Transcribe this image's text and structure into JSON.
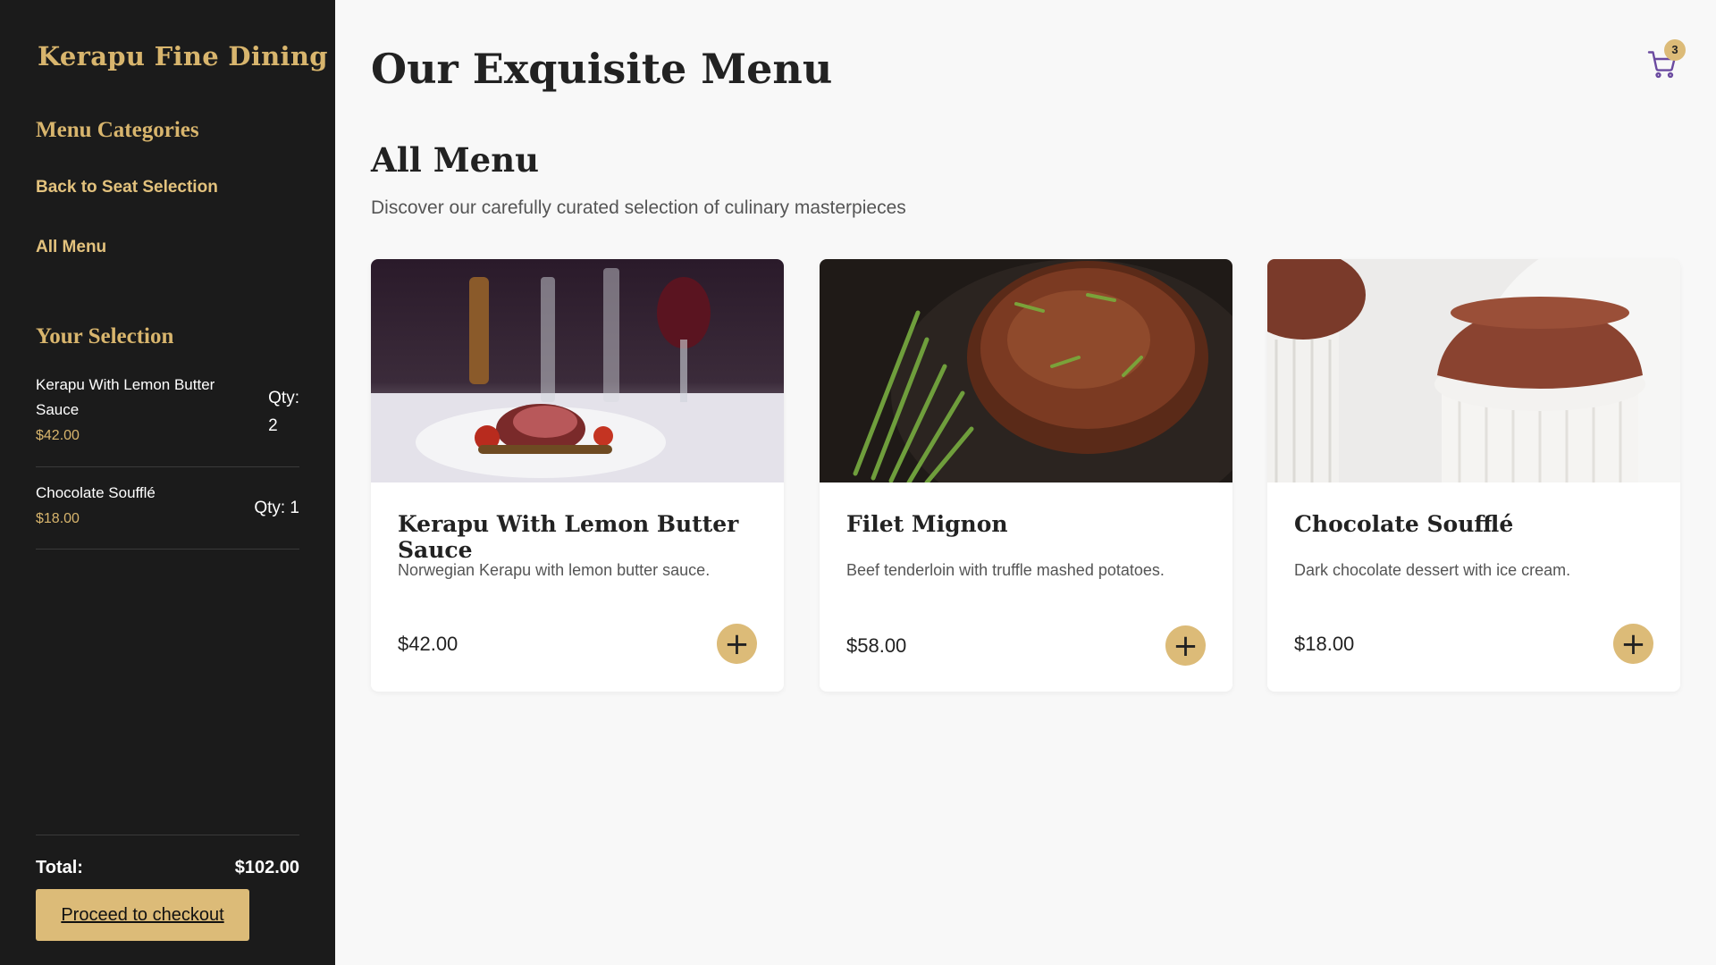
{
  "sidebar": {
    "brand": "Kerapu Fine Dining",
    "categories_title": "Menu Categories",
    "links": [
      "Back to Seat Selection",
      "All Menu"
    ],
    "selection_title": "Your Selection",
    "selection": [
      {
        "name": "Kerapu With Lemon Butter Sauce",
        "price": "$42.00",
        "qty_label": "Qty:",
        "qty": "2"
      },
      {
        "name": "Chocolate Soufflé",
        "price": "$18.00",
        "qty_label": "Qty: 1"
      }
    ],
    "total_label": "Total:",
    "total_value": "$102.00",
    "checkout_label": "Proceed to checkout"
  },
  "header": {
    "title": "Our Exquisite Menu",
    "cart_count": "3",
    "cart_icon": "cart-icon"
  },
  "section": {
    "title": "All Menu",
    "subtitle": "Discover our carefully curated selection of culinary masterpieces"
  },
  "menu": [
    {
      "name": "Kerapu With Lemon Butter Sauce",
      "desc": "Norwegian Kerapu with lemon butter sauce.",
      "price": "$42.00"
    },
    {
      "name": "Filet Mignon",
      "desc": "Beef tenderloin with truffle mashed potatoes.",
      "price": "$58.00"
    },
    {
      "name": "Chocolate Soufflé",
      "desc": "Dark chocolate dessert with ice cream.",
      "price": "$18.00"
    }
  ],
  "colors": {
    "accent": "#dcbb78",
    "sidebar_bg": "#1b1b1b",
    "page_bg": "#f8f8f8"
  }
}
